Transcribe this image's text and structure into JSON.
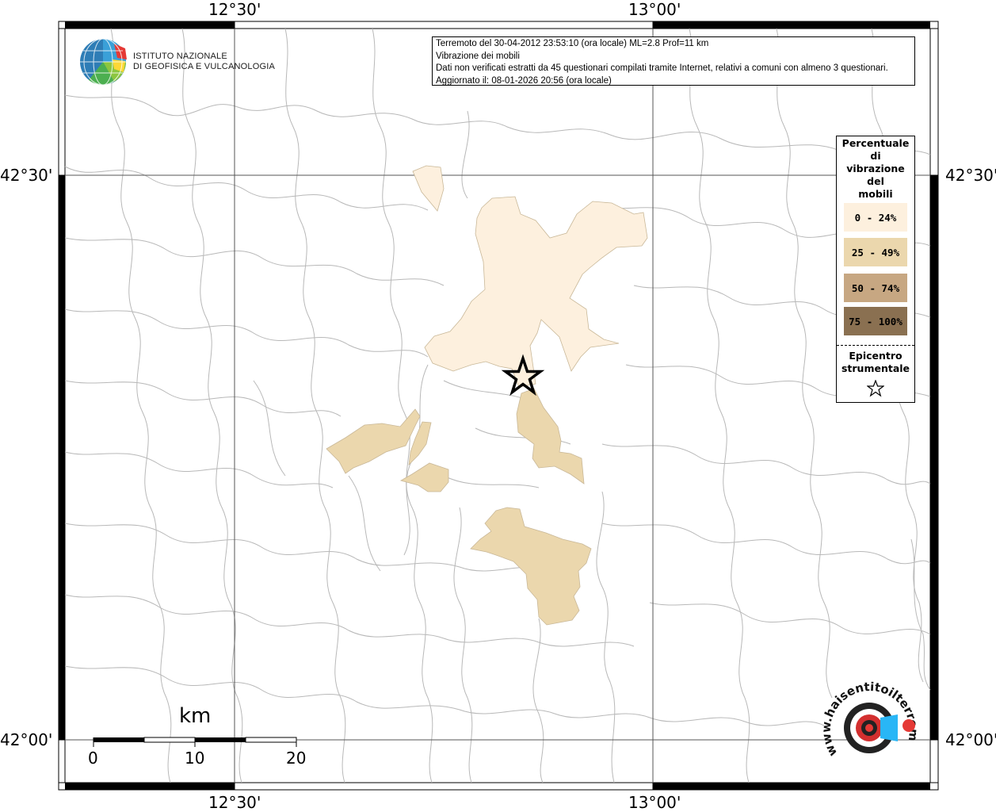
{
  "map": {
    "coords": {
      "top_left": "12°30'",
      "top_right": "13°00'",
      "bottom_left": "12°30'",
      "bottom_right": "13°00'",
      "left_top": "42°30'",
      "left_bottom": "42°00'",
      "right_top": "42°30'",
      "right_bottom": "42°00'"
    },
    "colors": {
      "class_0_24": "#fdf0de",
      "class_25_49": "#ebd7ad",
      "class_50_74": "#c7a782",
      "class_75_100": "#8a7051",
      "boundary": "#b8b8b8"
    }
  },
  "logo_ingv": {
    "line1": "ISTITUTO NAZIONALE",
    "line2": "DI GEOFISICA E VULCANOLOGIA"
  },
  "info": {
    "line1": "Terremoto del 30-04-2012 23:53:10 (ora locale) ML=2.8 Prof=11 km",
    "line2": "Vibrazione dei mobili",
    "line3": "Dati non verificati estratti da 45 questionari compilati tramite Internet, relativi a comuni con almeno 3 questionari.",
    "line4": "Aggiornato il: 08-01-2026 20:56 (ora locale)"
  },
  "legend": {
    "title": "Percentuale\ndi\nvibrazione\ndel\nmobili",
    "items": [
      {
        "label": "0 - 24%"
      },
      {
        "label": "25 - 49%"
      },
      {
        "label": "50 - 74%"
      },
      {
        "label": "75 - 100%"
      }
    ],
    "epicenter_title": "Epicentro\nstrumentale",
    "epicenter_icon": "star-icon"
  },
  "scale": {
    "title": "km",
    "labels": [
      "0",
      "10",
      "20"
    ]
  },
  "logo_hsl": {
    "text": "www.haisentitoilterremoto.it"
  }
}
